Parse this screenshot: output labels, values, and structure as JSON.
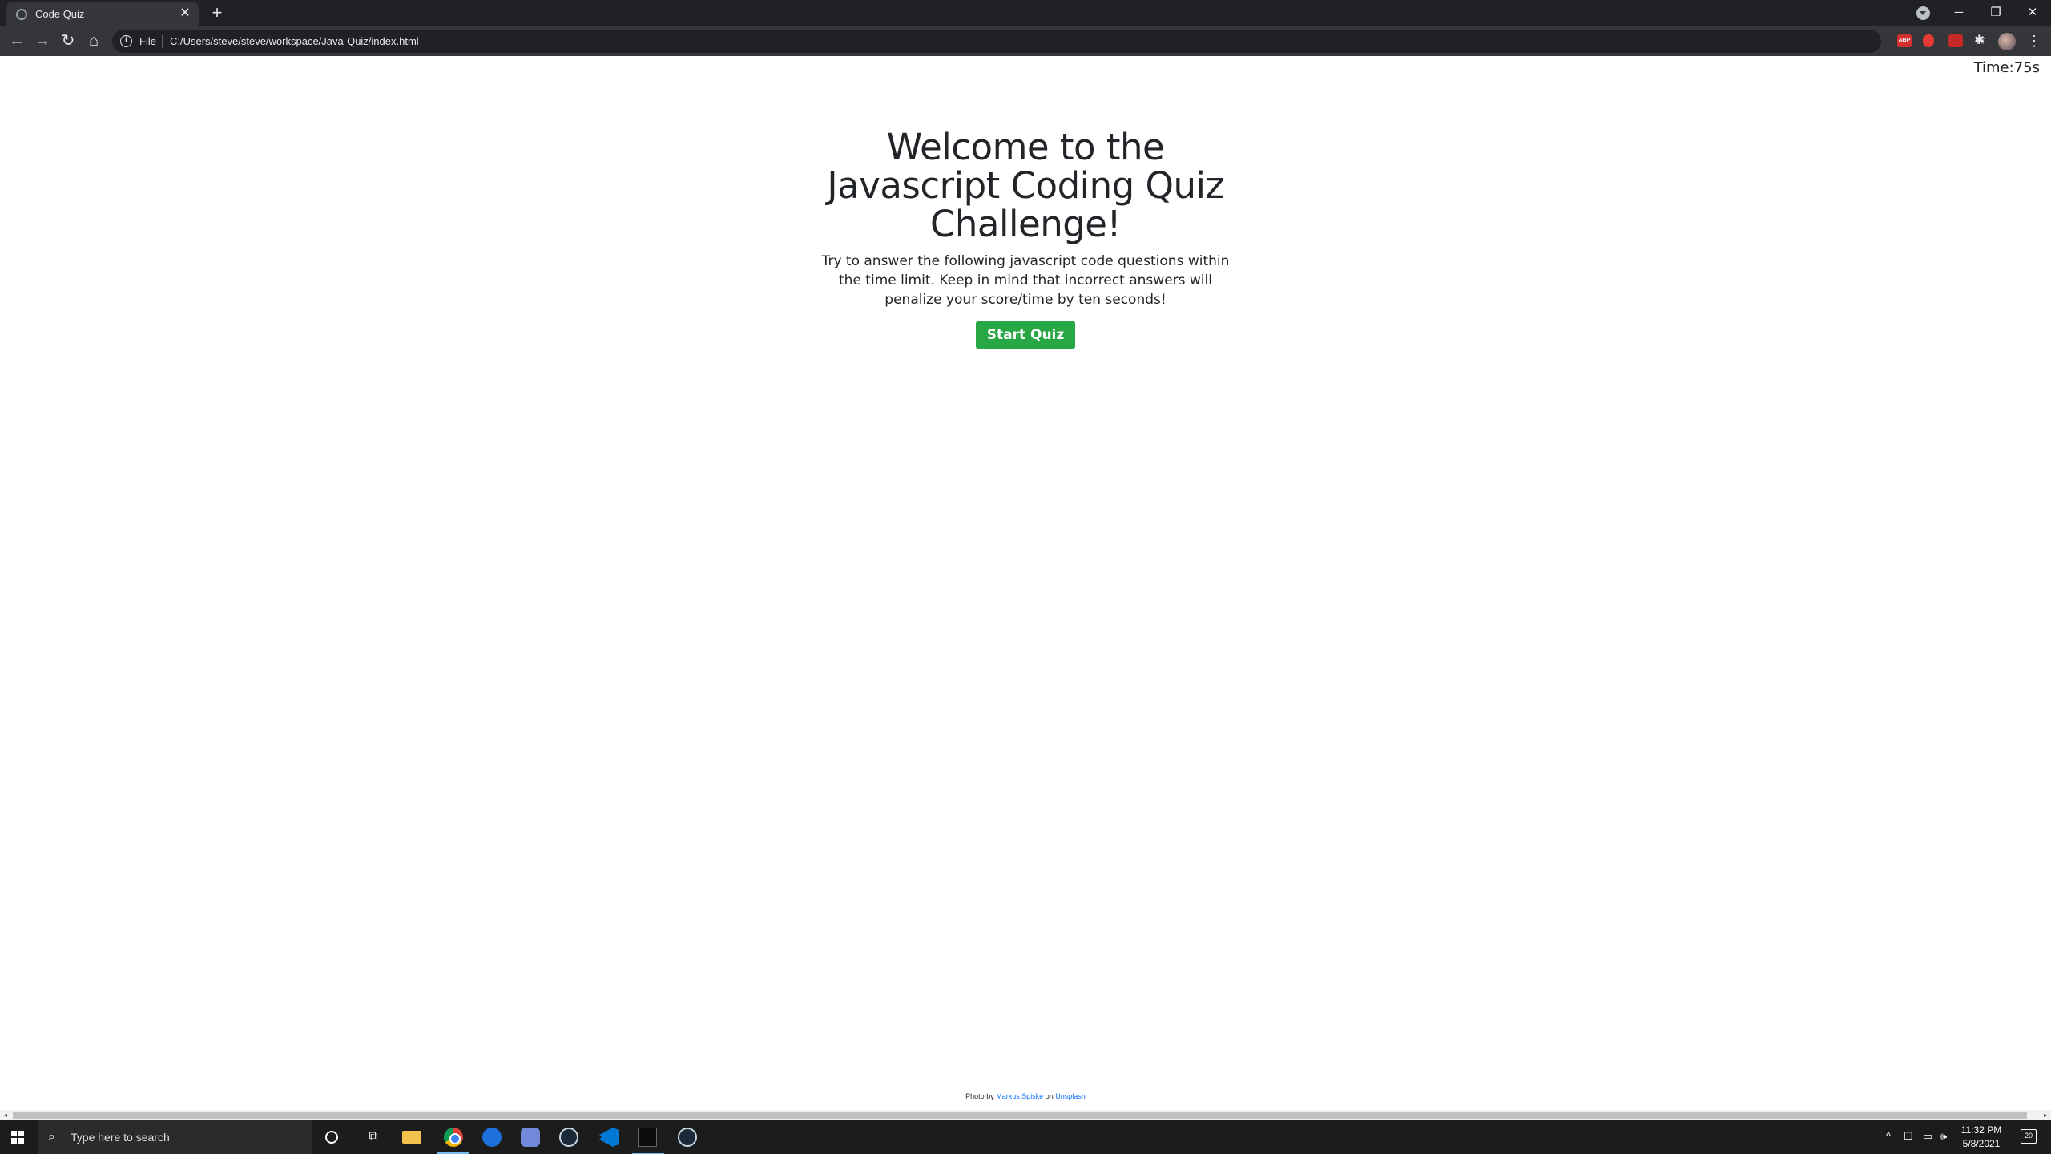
{
  "browser": {
    "tab_title": "Code Quiz",
    "tab_close": "✕",
    "new_tab": "+",
    "minimize": "─",
    "restore": "❐",
    "close": "✕",
    "back": "←",
    "forward": "→",
    "reload": "↻",
    "home": "⌂",
    "info_icon": "i",
    "file_label": "File",
    "url": "C:/Users/steve/steve/workspace/Java-Quiz/index.html",
    "star": "☆",
    "extensions": [
      "ABP",
      "red-shield-icon",
      "mail-icon",
      "puzzle-icon"
    ],
    "abp_label": "ABP",
    "puzzle": "✱",
    "menu": "⋮"
  },
  "page": {
    "timer_label": "Time:",
    "timer_value": "75s",
    "title": "Welcome to the Javascript Coding Quiz Challenge!",
    "description": "Try to answer the following javascript code questions within the time limit. Keep in mind that incorrect answers will penalize your score/time by ten seconds!",
    "start_button": "Start Quiz",
    "credit_prefix": "Photo by",
    "credit_author": "Markus Spiske",
    "credit_middle": "on",
    "credit_site": "Unsplash"
  },
  "scrollbar": {
    "left_arrow": "◂",
    "right_arrow": "▸"
  },
  "taskbar": {
    "search_placeholder": "Type here to search",
    "search_icon": "⌕",
    "taskview_icon": "⧉",
    "tray_up": "^",
    "tray_icons": [
      "☐",
      "▭",
      "🕪"
    ],
    "time": "11:32 PM",
    "date": "5/8/2021",
    "notification_count": "20"
  },
  "colors": {
    "start_button": "#28a745",
    "link": "#0d6efd",
    "chrome_dark": "#202124",
    "toolbar": "#35363a"
  }
}
